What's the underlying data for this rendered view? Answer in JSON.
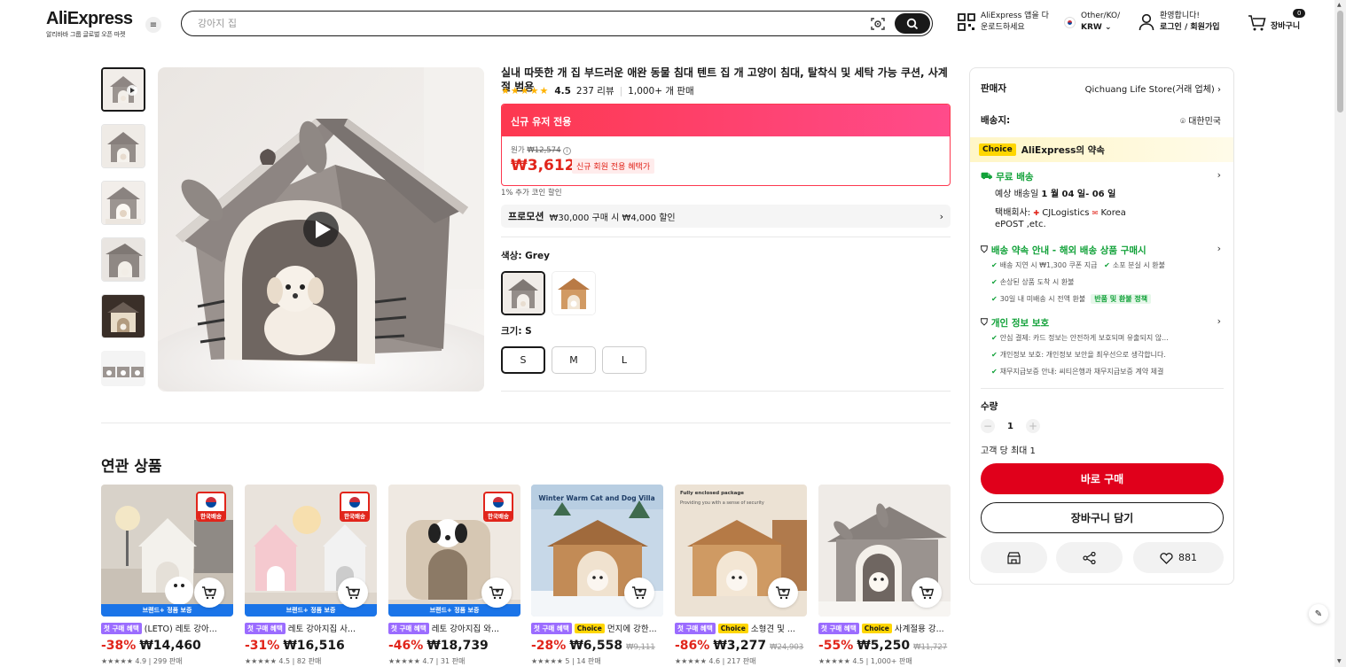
{
  "header": {
    "logo": "AliExpress",
    "logo_sub": "알리바바 그룹 글로벌 오픈 마켓",
    "search_placeholder": "강아지 집",
    "app_line1": "AliExpress 앱을 다",
    "app_line2": "운로드하세요",
    "region_line1": "Other/KO/",
    "region_line2": "KRW",
    "welcome": "환영합니다!",
    "login": "로그인 / 회원가입",
    "cart_count": "0",
    "cart_label": "장바구니"
  },
  "product": {
    "title": "실내 따뜻한 개 집 부드러운 애완 동물 침대 텐트 집 개 고양이 침대, 탈착식 및 세탁 가능 쿠션, 사계절 범용",
    "rating": "4.5",
    "reviews": "237 리뷰",
    "sold": "1,000+ 개 판매",
    "deal_header": "신규 유저 전용",
    "orig_label": "원가",
    "orig_price": "₩12,574",
    "price": "₩3,612",
    "price_tag": "신규 회원 전용 혜택가",
    "coin_note": "1% 추가 코인 할인",
    "promo_label": "프로모션",
    "promo_text": "₩30,000 구매 시 ₩4,000 할인",
    "color_label": "색상: Grey",
    "size_label": "크기: S",
    "sizes": [
      "S",
      "M",
      "L"
    ]
  },
  "side": {
    "seller_label": "판매자",
    "seller_name": "Qichuang Life Store(거래 업체)",
    "ship_to_label": "배송지:",
    "ship_to": "대한민국",
    "choice_badge": "Choice",
    "choice_text": "AliExpress의 약속",
    "free_ship": "무료 배송",
    "eta_prefix": "예상 배송일",
    "eta_dates": "1 월 04 일- 06 일",
    "carrier_line1": "택배회사:",
    "carrier_cj": "CJLogistics",
    "carrier_korea": "Korea",
    "carrier_line2": "ePOST ,etc.",
    "promise_title": "배송 약속 안내 - 해외 배송 상품 구매시",
    "promise_1": "배송 지연 시 ₩1,300 쿠폰 지급",
    "promise_2": "소포 분실 시 환불",
    "promise_3": "손상된 상품 도착 시 환불",
    "promise_4": "30일 내 미배송 시 전액 환불",
    "promise_tag": "반품 및 환불 정책",
    "privacy_title": "개인 정보 보호",
    "privacy_1": "안심 결제: 카드 정보는 안전하게 보호되며 유출되지 않...",
    "privacy_2": "개인정보 보호: 개인정보 보안을 최우선으로 생각합니다.",
    "privacy_3": "채무지급보증 안내: 씨티은행과 채무지급보증 계약 체결",
    "qty_label": "수량",
    "qty_value": "1",
    "max_note": "고객 당 최대 1",
    "buy_now": "바로 구매",
    "add_cart": "장바구니 담기",
    "wish_count": "881"
  },
  "related": {
    "title": "연관 상품",
    "items": [
      {
        "tag1": "첫 구매 혜택",
        "choice": "",
        "title": "(LETO) 레토 강아...",
        "disc": "-38%",
        "price": "₩14,460",
        "old": "",
        "rating": "★★★★★ 4.9 | 299 판매",
        "bar": "브랜드+ 정품 보증",
        "flag": "한국배송"
      },
      {
        "tag1": "첫 구매 혜택",
        "choice": "",
        "title": "레토 강아지집 사...",
        "disc": "-31%",
        "price": "₩16,516",
        "old": "",
        "rating": "★★★★★ 4.5 | 82 판매",
        "bar": "브랜드+ 정품 보증",
        "flag": "한국배송"
      },
      {
        "tag1": "첫 구매 혜택",
        "choice": "",
        "title": "레토 강아지집 와...",
        "disc": "-46%",
        "price": "₩18,739",
        "old": "",
        "rating": "★★★★★ 4.7 | 31 판매",
        "bar": "브랜드+ 정품 보증",
        "flag": "한국배송"
      },
      {
        "tag1": "첫 구매 혜택",
        "choice": "Choice",
        "title": "먼지에 강한...",
        "disc": "-28%",
        "price": "₩6,558",
        "old": "₩9,111",
        "rating": "★★★★★ 5 | 14 판매",
        "bar": "",
        "flag": ""
      },
      {
        "tag1": "첫 구매 혜택",
        "choice": "Choice",
        "title": "소형견 및 ...",
        "disc": "-86%",
        "price": "₩3,277",
        "old": "₩24,903",
        "rating": "★★★★★ 4.6 | 217 판매",
        "bar": "",
        "flag": ""
      },
      {
        "tag1": "첫 구매 혜택",
        "choice": "Choice",
        "title": "사계절용 강...",
        "disc": "-55%",
        "price": "₩5,250",
        "old": "₩11,727",
        "rating": "★★★★★ 4.5 | 1,000+ 판매",
        "bar": "",
        "flag": ""
      }
    ]
  },
  "banners": {
    "card4": "Winter Warm Cat and Dog Villa",
    "card5_line1": "Fully enclosed package",
    "card5_line2": "Providing you with a sense of security"
  },
  "colors": {
    "accent_red": "#e0001b",
    "price_red": "#e1251b",
    "choice_yellow": "#ffd600",
    "green": "#10a138"
  },
  "icons": [
    "menu-icon",
    "camera-search-icon",
    "search-icon",
    "qr-icon",
    "flag-kr-icon",
    "user-icon",
    "cart-icon",
    "play-icon",
    "chevron-right-icon",
    "location-pin-icon",
    "truck-icon",
    "shield-icon",
    "lock-shield-icon",
    "check-icon",
    "store-icon",
    "share-icon",
    "heart-icon",
    "add-to-cart-icon",
    "edit-icon"
  ]
}
